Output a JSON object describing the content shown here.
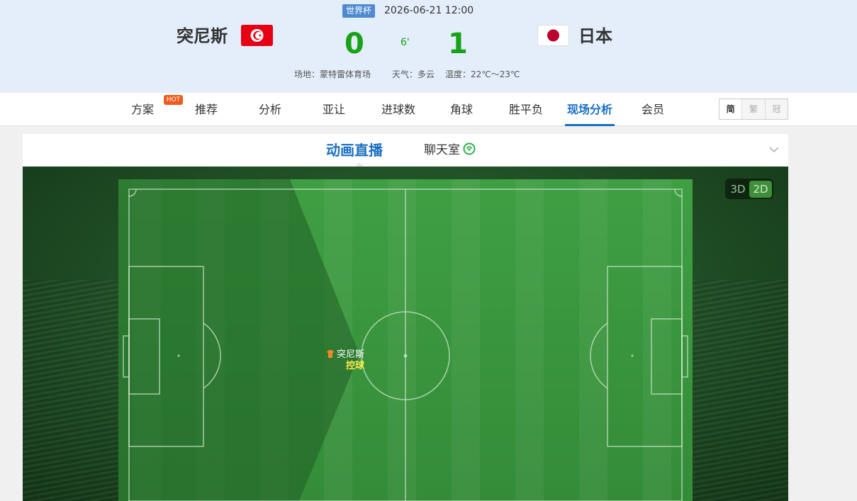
{
  "match": {
    "league": "世界杯",
    "datetime": "2026-06-21 12:00",
    "home": {
      "name": "突尼斯",
      "flag_icon": "tunisia-flag-icon",
      "score": "0"
    },
    "away": {
      "name": "日本",
      "flag_icon": "japan-flag-icon",
      "score": "1"
    },
    "minute": "6'",
    "venue": "场地：蒙特雷体育场",
    "weather": "天气：多云",
    "temperature": "温度：22℃～23℃"
  },
  "nav": {
    "tabs": [
      {
        "label": "方案"
      },
      {
        "label": "推荐"
      },
      {
        "label": "分析"
      },
      {
        "label": "亚让"
      },
      {
        "label": "进球数"
      },
      {
        "label": "角球"
      },
      {
        "label": "胜平负"
      },
      {
        "label": "现场分析"
      },
      {
        "label": "会员"
      }
    ],
    "hot_badge": "HOT",
    "active_tab": "现场分析",
    "lang": [
      "简",
      "繁",
      "冠"
    ],
    "active_lang": "简"
  },
  "live": {
    "tabs": [
      "动画直播",
      "聊天室"
    ],
    "active_tab": "动画直播",
    "view_modes": [
      "3D",
      "2D"
    ],
    "active_view": "2D",
    "possession": {
      "team": "突尼斯",
      "state": "控球"
    }
  },
  "colors": {
    "accent": "#1a6fc2",
    "score": "#17a217",
    "pitch": "#3a9a3e",
    "possession_text": "#ffe94d",
    "hot": "#f05a1c"
  }
}
